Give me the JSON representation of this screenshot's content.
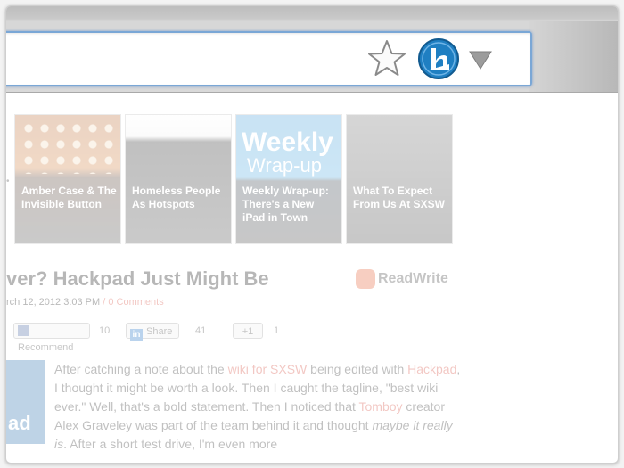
{
  "toolbar": {
    "star_icon": "star-outline-icon",
    "extension_icon": "hackpad-extension-icon",
    "menu_icon": "triangle-down-icon",
    "extension_color": "#1f7fc2"
  },
  "thumbnails": [
    {
      "caption": "Amber Case & The Invisible Button"
    },
    {
      "caption": "Homeless People As Hotspots"
    },
    {
      "caption": "Weekly Wrap-up: There's a New iPad in Town",
      "image_text_line1": "Weekly",
      "image_text_line2": "Wrap-up"
    },
    {
      "caption": "What To Expect From Us At SXSW"
    }
  ],
  "article": {
    "headline": "ver? Hackpad Just Might Be",
    "logo_text": "ReadWrite",
    "date": "rch 12, 2012 3:03 PM",
    "separator": " / ",
    "comments": "0 Comments",
    "social": {
      "recommend_label": "Recommend",
      "recommend_count": "10",
      "share_label": "Share",
      "share_count": "41",
      "plus_label": "+1",
      "plus_count": "1"
    },
    "side_image_text": "ad",
    "body": {
      "p1": "After catching a note about the ",
      "link1": "wiki for SXSW",
      "p2": " being edited with ",
      "link2": "Hackpad",
      "p3": ", I thought it might be worth a look. Then I caught the tagline, \"best wiki ever.\" Well, that's a bold statement. Then I noticed that ",
      "link3": "Tomboy",
      "p4": " creator Alex Graveley was part of the team behind it and thought ",
      "em": "maybe it really is",
      "p5": ". After a short test drive, I'm even more"
    }
  }
}
